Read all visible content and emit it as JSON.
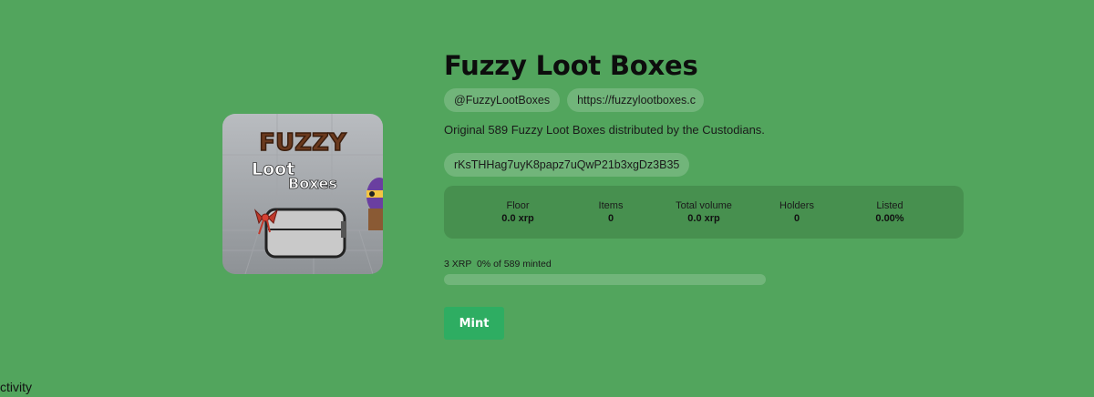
{
  "collection": {
    "name": "Fuzzy Loot Boxes",
    "handle": "@FuzzyLootBoxes",
    "website": "https://fuzzylootboxes.c",
    "description": "Original 589 Fuzzy Loot Boxes distributed by the Custodians.",
    "issuer_address": "rKsTHHag7uyK8papz7uQwP21b3xgDz3B35",
    "artwork": {
      "title_word": "FUZZY",
      "line1": "Loot",
      "line2": "Boxes"
    }
  },
  "stats": [
    {
      "label": "Floor",
      "value": "0.0 xrp"
    },
    {
      "label": "Items",
      "value": "0"
    },
    {
      "label": "Total volume",
      "value": "0.0 xrp"
    },
    {
      "label": "Holders",
      "value": "0"
    },
    {
      "label": "Listed",
      "value": "0.00%"
    }
  ],
  "mint": {
    "progress_text": "3 XRP  0% of 589 minted",
    "progress_fraction": 0,
    "button_label": "Mint"
  },
  "tabs": {
    "activity_label": "ctivity"
  },
  "colors": {
    "background": "#52a55d",
    "panel": "#47904f",
    "accent": "#2ead62"
  }
}
